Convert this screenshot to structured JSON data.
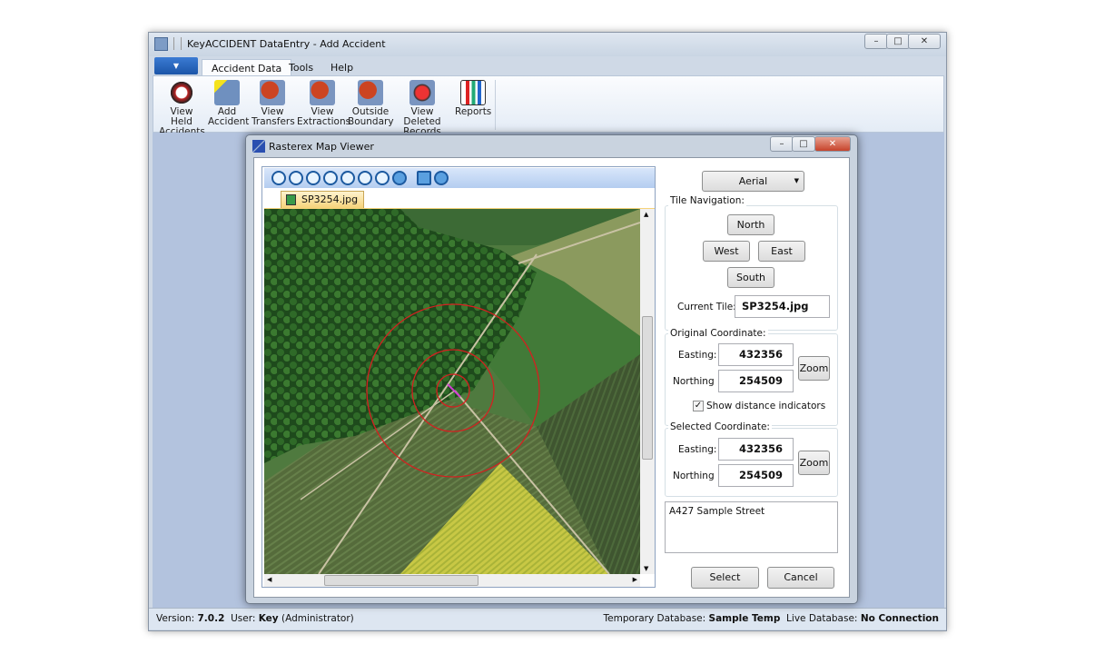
{
  "app": {
    "title": "KeyACCIDENT DataEntry - Add Accident",
    "tabs": [
      "Accident Data",
      "Tools",
      "Help"
    ],
    "ribbon": [
      {
        "label1": "View Held",
        "label2": "Accidents",
        "icon": "held-accidents-icon"
      },
      {
        "label1": "Add",
        "label2": "Accident",
        "icon": "add-accident-icon"
      },
      {
        "label1": "View",
        "label2": "Transfers",
        "icon": "transfers-icon"
      },
      {
        "label1": "View",
        "label2": "Extractions",
        "icon": "extractions-icon"
      },
      {
        "label1": "Outside",
        "label2": "Boundary",
        "icon": "outside-boundary-icon"
      },
      {
        "label1": "View Deleted",
        "label2": "Records",
        "icon": "deleted-records-icon"
      },
      {
        "label1": "Reports",
        "label2": "",
        "icon": "reports-icon"
      }
    ],
    "status": {
      "version_label": "Version:",
      "version": "7.0.2",
      "user_label": "User:",
      "user": "Key",
      "role": "(Administrator)",
      "temp_db_label": "Temporary Database:",
      "temp_db": "Sample Temp",
      "live_db_label": "Live Database:",
      "live_db": "No Connection"
    }
  },
  "viewer": {
    "title": "Rasterex Map Viewer",
    "toolbar": [
      "zoom-window-icon",
      "zoom-actual-icon",
      "zoom-in-icon",
      "zoom-out-icon",
      "zoom-fit-icon",
      "zoom-extents-icon",
      "zoom-area-icon",
      "pan-hand-icon",
      "snapshot-icon",
      "home-icon"
    ],
    "file_tab": "SP3254.jpg",
    "map_type": "Aerial",
    "tile_nav": {
      "label": "Tile Navigation:",
      "north": "North",
      "west": "West",
      "east": "East",
      "south": "South",
      "current_label": "Current Tile:",
      "current": "SP3254.jpg"
    },
    "original": {
      "label": "Original Coordinate:",
      "easting_label": "Easting:",
      "easting": "432356",
      "northing_label": "Northing",
      "northing": "254509",
      "zoom": "Zoom",
      "show_distance": "Show distance indicators",
      "show_distance_checked": true
    },
    "selected": {
      "label": "Selected Coordinate:",
      "easting_label": "Easting:",
      "easting": "432356",
      "northing_label": "Northing",
      "northing": "254509",
      "zoom": "Zoom"
    },
    "address": "A427 Sample Street",
    "select": "Select",
    "cancel": "Cancel",
    "colors": {
      "circle": "#d42020",
      "marker": "#d040d0"
    }
  }
}
